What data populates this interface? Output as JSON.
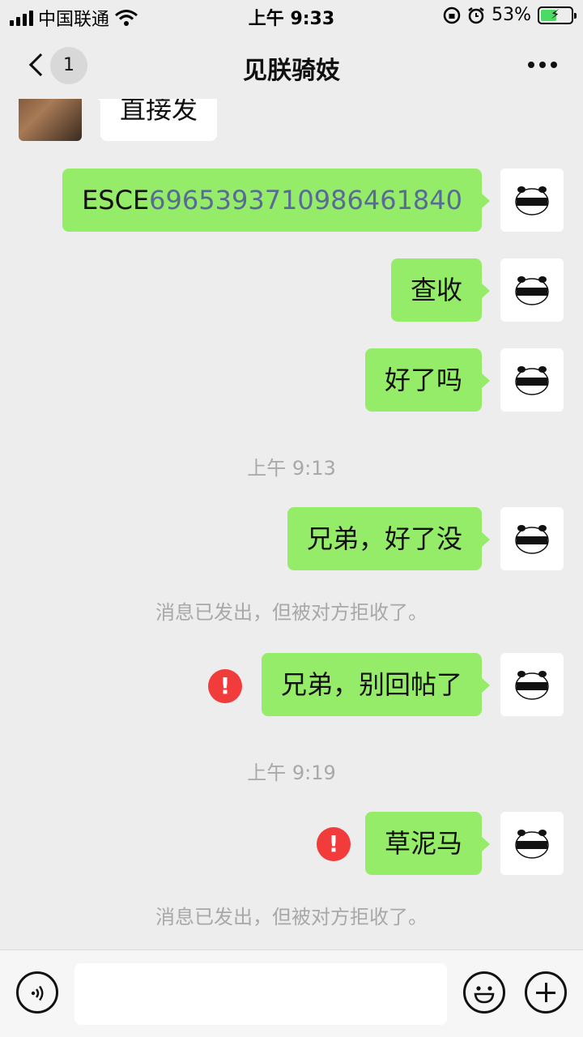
{
  "status_bar": {
    "carrier": "中国联通",
    "time": "上午 9:33",
    "battery": "53%",
    "battery_level": 0.53
  },
  "nav": {
    "unread_count": "1",
    "title": "见朕骑妓"
  },
  "messages": {
    "m0": "直接发",
    "m1_prefix": "ESCE",
    "m1_number": "6965393710986461840",
    "m2": "查收",
    "m3": "好了吗",
    "t1": "上午 9:13",
    "m4": "兄弟，好了没",
    "sys1": "消息已发出，但被对方拒收了。",
    "m5": "兄弟，别回帖了",
    "m5_error": "!",
    "t2": "上午 9:19",
    "m6": "草泥马",
    "m6_error": "!",
    "sys2": "消息已发出，但被对方拒收了。"
  },
  "input": {
    "placeholder": "",
    "value": ""
  },
  "colors": {
    "bubble_out": "#95ec69",
    "bubble_in": "#ffffff",
    "link": "#576b95",
    "error": "#f23c3c",
    "background": "#ededed"
  }
}
